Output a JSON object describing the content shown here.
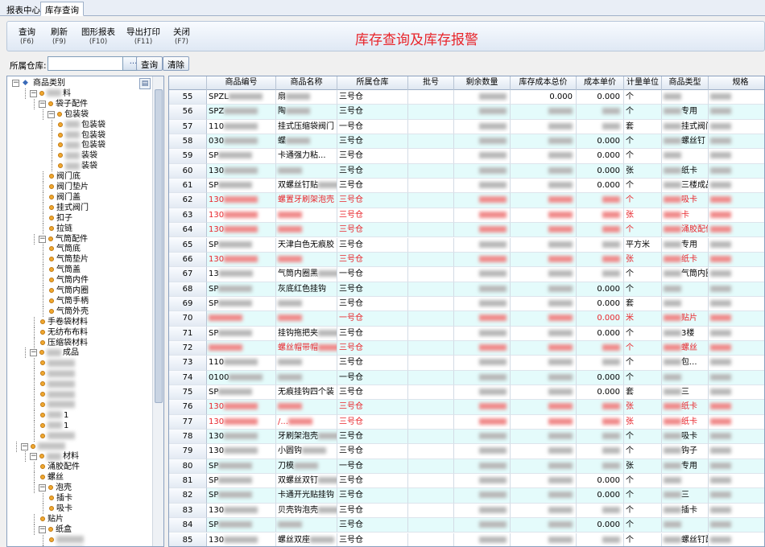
{
  "tabs": [
    "报表中心",
    "库存查询"
  ],
  "toolbar": {
    "buttons": [
      {
        "label": "查询",
        "key": "(F6)"
      },
      {
        "label": "刷新",
        "key": "(F9)"
      },
      {
        "label": "图形报表",
        "key": "(F10)"
      },
      {
        "label": "导出打印",
        "key": "(F11)"
      },
      {
        "label": "关闭",
        "key": "(F7)"
      }
    ],
    "title": "库存查询及库存报警"
  },
  "filter": {
    "label": "所属仓库:",
    "value": "",
    "dots": "...",
    "query_button": "查询",
    "clear_button": "清除"
  },
  "tree": {
    "root": "商品类别",
    "nodes": [
      {
        "label": "料",
        "level": 2,
        "blurred": true,
        "toggle": "-"
      },
      {
        "label": "袋子配件",
        "level": 3,
        "toggle": "-"
      },
      {
        "label": "包装袋",
        "level": 4,
        "toggle": "-"
      },
      {
        "label": "包装袋",
        "level": 5,
        "blurred": true
      },
      {
        "label": "包装袋",
        "level": 5,
        "blurred": true
      },
      {
        "label": "包装袋",
        "level": 5,
        "blurred": true
      },
      {
        "label": "装袋",
        "level": 5,
        "blurred": true
      },
      {
        "label": "装袋",
        "level": 5,
        "blurred": true
      },
      {
        "label": "阀门底",
        "level": 4
      },
      {
        "label": "阀门垫片",
        "level": 4
      },
      {
        "label": "阀门盖",
        "level": 4
      },
      {
        "label": "挂式阀门",
        "level": 4
      },
      {
        "label": "扣子",
        "level": 4
      },
      {
        "label": "拉链",
        "level": 4
      },
      {
        "label": "气筒配件",
        "level": 3,
        "toggle": "-"
      },
      {
        "label": "气筒底",
        "level": 4
      },
      {
        "label": "气筒垫片",
        "level": 4
      },
      {
        "label": "气筒盖",
        "level": 4
      },
      {
        "label": "气筒内件",
        "level": 4
      },
      {
        "label": "气筒内圈",
        "level": 4
      },
      {
        "label": "气筒手柄",
        "level": 4
      },
      {
        "label": "气筒外壳",
        "level": 4
      },
      {
        "label": "手卷袋材料",
        "level": 3
      },
      {
        "label": "无纺布布料",
        "level": 3
      },
      {
        "label": "压缩袋材料",
        "level": 3
      },
      {
        "label": "成品",
        "level": 2,
        "blurred": true,
        "toggle": "-"
      },
      {
        "label": "",
        "level": 3,
        "blurred": true
      },
      {
        "label": "",
        "level": 3,
        "blurred": true
      },
      {
        "label": "",
        "level": 3,
        "blurred": true
      },
      {
        "label": "",
        "level": 3,
        "blurred": true
      },
      {
        "label": "",
        "level": 3,
        "blurred": true
      },
      {
        "label": "1",
        "level": 3,
        "blurred": true
      },
      {
        "label": "1",
        "level": 3,
        "blurred": true
      },
      {
        "label": "",
        "level": 3,
        "blurred": true
      },
      {
        "label": "",
        "level": 1,
        "blurred": true,
        "toggle": "-"
      },
      {
        "label": "材料",
        "level": 2,
        "blurred": true,
        "toggle": "-"
      },
      {
        "label": "涌胶配件",
        "level": 3
      },
      {
        "label": "螺丝",
        "level": 3
      },
      {
        "label": "泡壳",
        "level": 3,
        "toggle": "-"
      },
      {
        "label": "插卡",
        "level": 4
      },
      {
        "label": "吸卡",
        "level": 4
      },
      {
        "label": "贴片",
        "level": 3
      },
      {
        "label": "纸盒",
        "level": 3,
        "toggle": "-"
      },
      {
        "label": "",
        "level": 4,
        "blurred": true
      },
      {
        "label": "",
        "level": 4,
        "blurred": true
      }
    ]
  },
  "grid": {
    "columns": [
      "商品编号",
      "商品名称",
      "所属仓库",
      "批号",
      "剩余数量",
      "库存成本总价",
      "成本单价",
      "计量单位",
      "商品类型",
      "规格"
    ],
    "rows": [
      {
        "n": "55",
        "code": "SPZL",
        "name": "扇",
        "wh": "三号仓",
        "qty": "",
        "total": "0.000",
        "price": "0.000",
        "unit": "个",
        "type": "",
        "spec": "",
        "red": false
      },
      {
        "n": "56",
        "code": "SPZ",
        "name": "陶",
        "wh": "三号仓",
        "qty": "",
        "total": "",
        "price": "",
        "unit": "个",
        "type": "专用",
        "spec": "",
        "red": false
      },
      {
        "n": "57",
        "code": "110",
        "name": "挂式压缩袋阀门",
        "wh": "一号仓",
        "qty": "",
        "total": "",
        "price": "",
        "unit": "套",
        "type": "挂式阀门",
        "spec": "",
        "red": false
      },
      {
        "n": "58",
        "code": "030",
        "name": "蝶",
        "wh": "三号仓",
        "qty": "",
        "total": "",
        "price": "0.000",
        "unit": "个",
        "type": "螺丝钉",
        "spec": "",
        "red": false
      },
      {
        "n": "59",
        "code": "SP",
        "name": "卡通强力粘...",
        "wh": "三号仓",
        "qty": "",
        "total": "",
        "price": "0.000",
        "unit": "个",
        "type": "",
        "spec": "",
        "red": false
      },
      {
        "n": "60",
        "code": "130",
        "name": "",
        "wh": "三号仓",
        "qty": "",
        "total": "",
        "price": "0.000",
        "unit": "张",
        "type": "纸卡",
        "spec": "",
        "red": false
      },
      {
        "n": "61",
        "code": "SP",
        "name": "双螺丝钉贴",
        "wh": "三号仓",
        "qty": "",
        "total": "",
        "price": "0.000",
        "unit": "个",
        "type": "三楼成品",
        "spec": "",
        "red": false
      },
      {
        "n": "62",
        "code": "130",
        "name": "螺置牙刷架泡壳",
        "wh": "三号仓",
        "qty": "",
        "total": "",
        "price": "",
        "unit": "个",
        "type": "吸卡",
        "spec": "",
        "red": true
      },
      {
        "n": "63",
        "code": "130",
        "name": "",
        "wh": "三号仓",
        "qty": "",
        "total": "",
        "price": "",
        "unit": "张",
        "type": "卡",
        "spec": "",
        "red": true
      },
      {
        "n": "64",
        "code": "130",
        "name": "",
        "wh": "三号仓",
        "qty": "",
        "total": "",
        "price": "",
        "unit": "个",
        "type": "涌胶配件",
        "spec": "",
        "red": true
      },
      {
        "n": "65",
        "code": "SP",
        "name": "天津白色无痕胶",
        "wh": "三号仓",
        "qty": "",
        "total": "",
        "price": "",
        "unit": "平方米",
        "type": "专用",
        "spec": "",
        "red": false
      },
      {
        "n": "66",
        "code": "130",
        "name": "",
        "wh": "三号仓",
        "qty": "",
        "total": "",
        "price": "",
        "unit": "张",
        "type": "纸卡",
        "spec": "",
        "red": true
      },
      {
        "n": "67",
        "code": "13",
        "name": "气筒内圈黑",
        "wh": "一号仓",
        "qty": "",
        "total": "",
        "price": "",
        "unit": "个",
        "type": "气筒内圈",
        "spec": "",
        "red": false
      },
      {
        "n": "68",
        "code": "SP",
        "name": "灰底红色挂钩",
        "wh": "三号仓",
        "qty": "",
        "total": "",
        "price": "0.000",
        "unit": "个",
        "type": "",
        "spec": "",
        "red": false
      },
      {
        "n": "69",
        "code": "SP",
        "name": "",
        "wh": "三号仓",
        "qty": "",
        "total": "",
        "price": "0.000",
        "unit": "套",
        "type": "",
        "spec": "",
        "red": false
      },
      {
        "n": "70",
        "code": "",
        "name": "",
        "wh": "一号仓",
        "qty": "",
        "total": "",
        "price": "0.000",
        "unit": "米",
        "type": "贴片",
        "spec": "",
        "red": true
      },
      {
        "n": "71",
        "code": "SP",
        "name": "挂钩拖把夹",
        "wh": "三号仓",
        "qty": "",
        "total": "",
        "price": "0.000",
        "unit": "个",
        "type": "3楼",
        "spec": "",
        "red": false
      },
      {
        "n": "72",
        "code": "",
        "name": "螺丝帽带帽",
        "wh": "三号仓",
        "qty": "",
        "total": "",
        "price": "",
        "unit": "个",
        "type": "螺丝",
        "spec": "",
        "red": true
      },
      {
        "n": "73",
        "code": "110",
        "name": "",
        "wh": "三号仓",
        "qty": "",
        "total": "",
        "price": "",
        "unit": "个",
        "type": "包...",
        "spec": "",
        "red": false
      },
      {
        "n": "74",
        "code": "0100",
        "name": "",
        "wh": "一号仓",
        "qty": "",
        "total": "",
        "price": "0.000",
        "unit": "个",
        "type": "",
        "spec": "",
        "red": false
      },
      {
        "n": "75",
        "code": "SP",
        "name": "无痕挂钩四个装",
        "wh": "三号仓",
        "qty": "",
        "total": "",
        "price": "0.000",
        "unit": "套",
        "type": "三",
        "spec": "",
        "red": false
      },
      {
        "n": "76",
        "code": "130",
        "name": "",
        "wh": "三号仓",
        "qty": "",
        "total": "",
        "price": "",
        "unit": "张",
        "type": "纸卡",
        "spec": "",
        "red": true
      },
      {
        "n": "77",
        "code": "130",
        "name": "/...",
        "wh": "三号仓",
        "qty": "",
        "total": "",
        "price": "",
        "unit": "张",
        "type": "纸卡",
        "spec": "",
        "red": true
      },
      {
        "n": "78",
        "code": "130",
        "name": "牙刷架泡壳",
        "wh": "三号仓",
        "qty": "",
        "total": "",
        "price": "",
        "unit": "个",
        "type": "吸卡",
        "spec": "",
        "red": false
      },
      {
        "n": "79",
        "code": "130",
        "name": "小圆钩",
        "wh": "三号仓",
        "qty": "",
        "total": "",
        "price": "",
        "unit": "个",
        "type": "钩子",
        "spec": "",
        "red": false
      },
      {
        "n": "80",
        "code": "SP",
        "name": "刀模",
        "wh": "一号仓",
        "qty": "",
        "total": "",
        "price": "",
        "unit": "张",
        "type": "专用",
        "spec": "",
        "red": false
      },
      {
        "n": "81",
        "code": "SP",
        "name": "双螺丝双钉",
        "wh": "三号仓",
        "qty": "",
        "total": "",
        "price": "0.000",
        "unit": "个",
        "type": "",
        "spec": "",
        "red": false
      },
      {
        "n": "82",
        "code": "SP",
        "name": "卡通开光贴挂钩",
        "wh": "三号仓",
        "qty": "",
        "total": "",
        "price": "0.000",
        "unit": "个",
        "type": "三",
        "spec": "",
        "red": false
      },
      {
        "n": "83",
        "code": "130",
        "name": "贝壳钩泡壳",
        "wh": "三号仓",
        "qty": "",
        "total": "",
        "price": "",
        "unit": "个",
        "type": "插卡",
        "spec": "",
        "red": false
      },
      {
        "n": "84",
        "code": "SP",
        "name": "",
        "wh": "三号仓",
        "qty": "",
        "total": "",
        "price": "0.000",
        "unit": "个",
        "type": "",
        "spec": "",
        "red": false
      },
      {
        "n": "85",
        "code": "130",
        "name": "螺丝双座",
        "wh": "三号仓",
        "qty": "",
        "total": "",
        "price": "",
        "unit": "个",
        "type": "螺丝钉配件",
        "spec": "",
        "red": false
      }
    ]
  },
  "colors": {
    "accent_red": "#e8242a",
    "row_alt": "#e4fbfb",
    "border": "#8aa0bf"
  }
}
